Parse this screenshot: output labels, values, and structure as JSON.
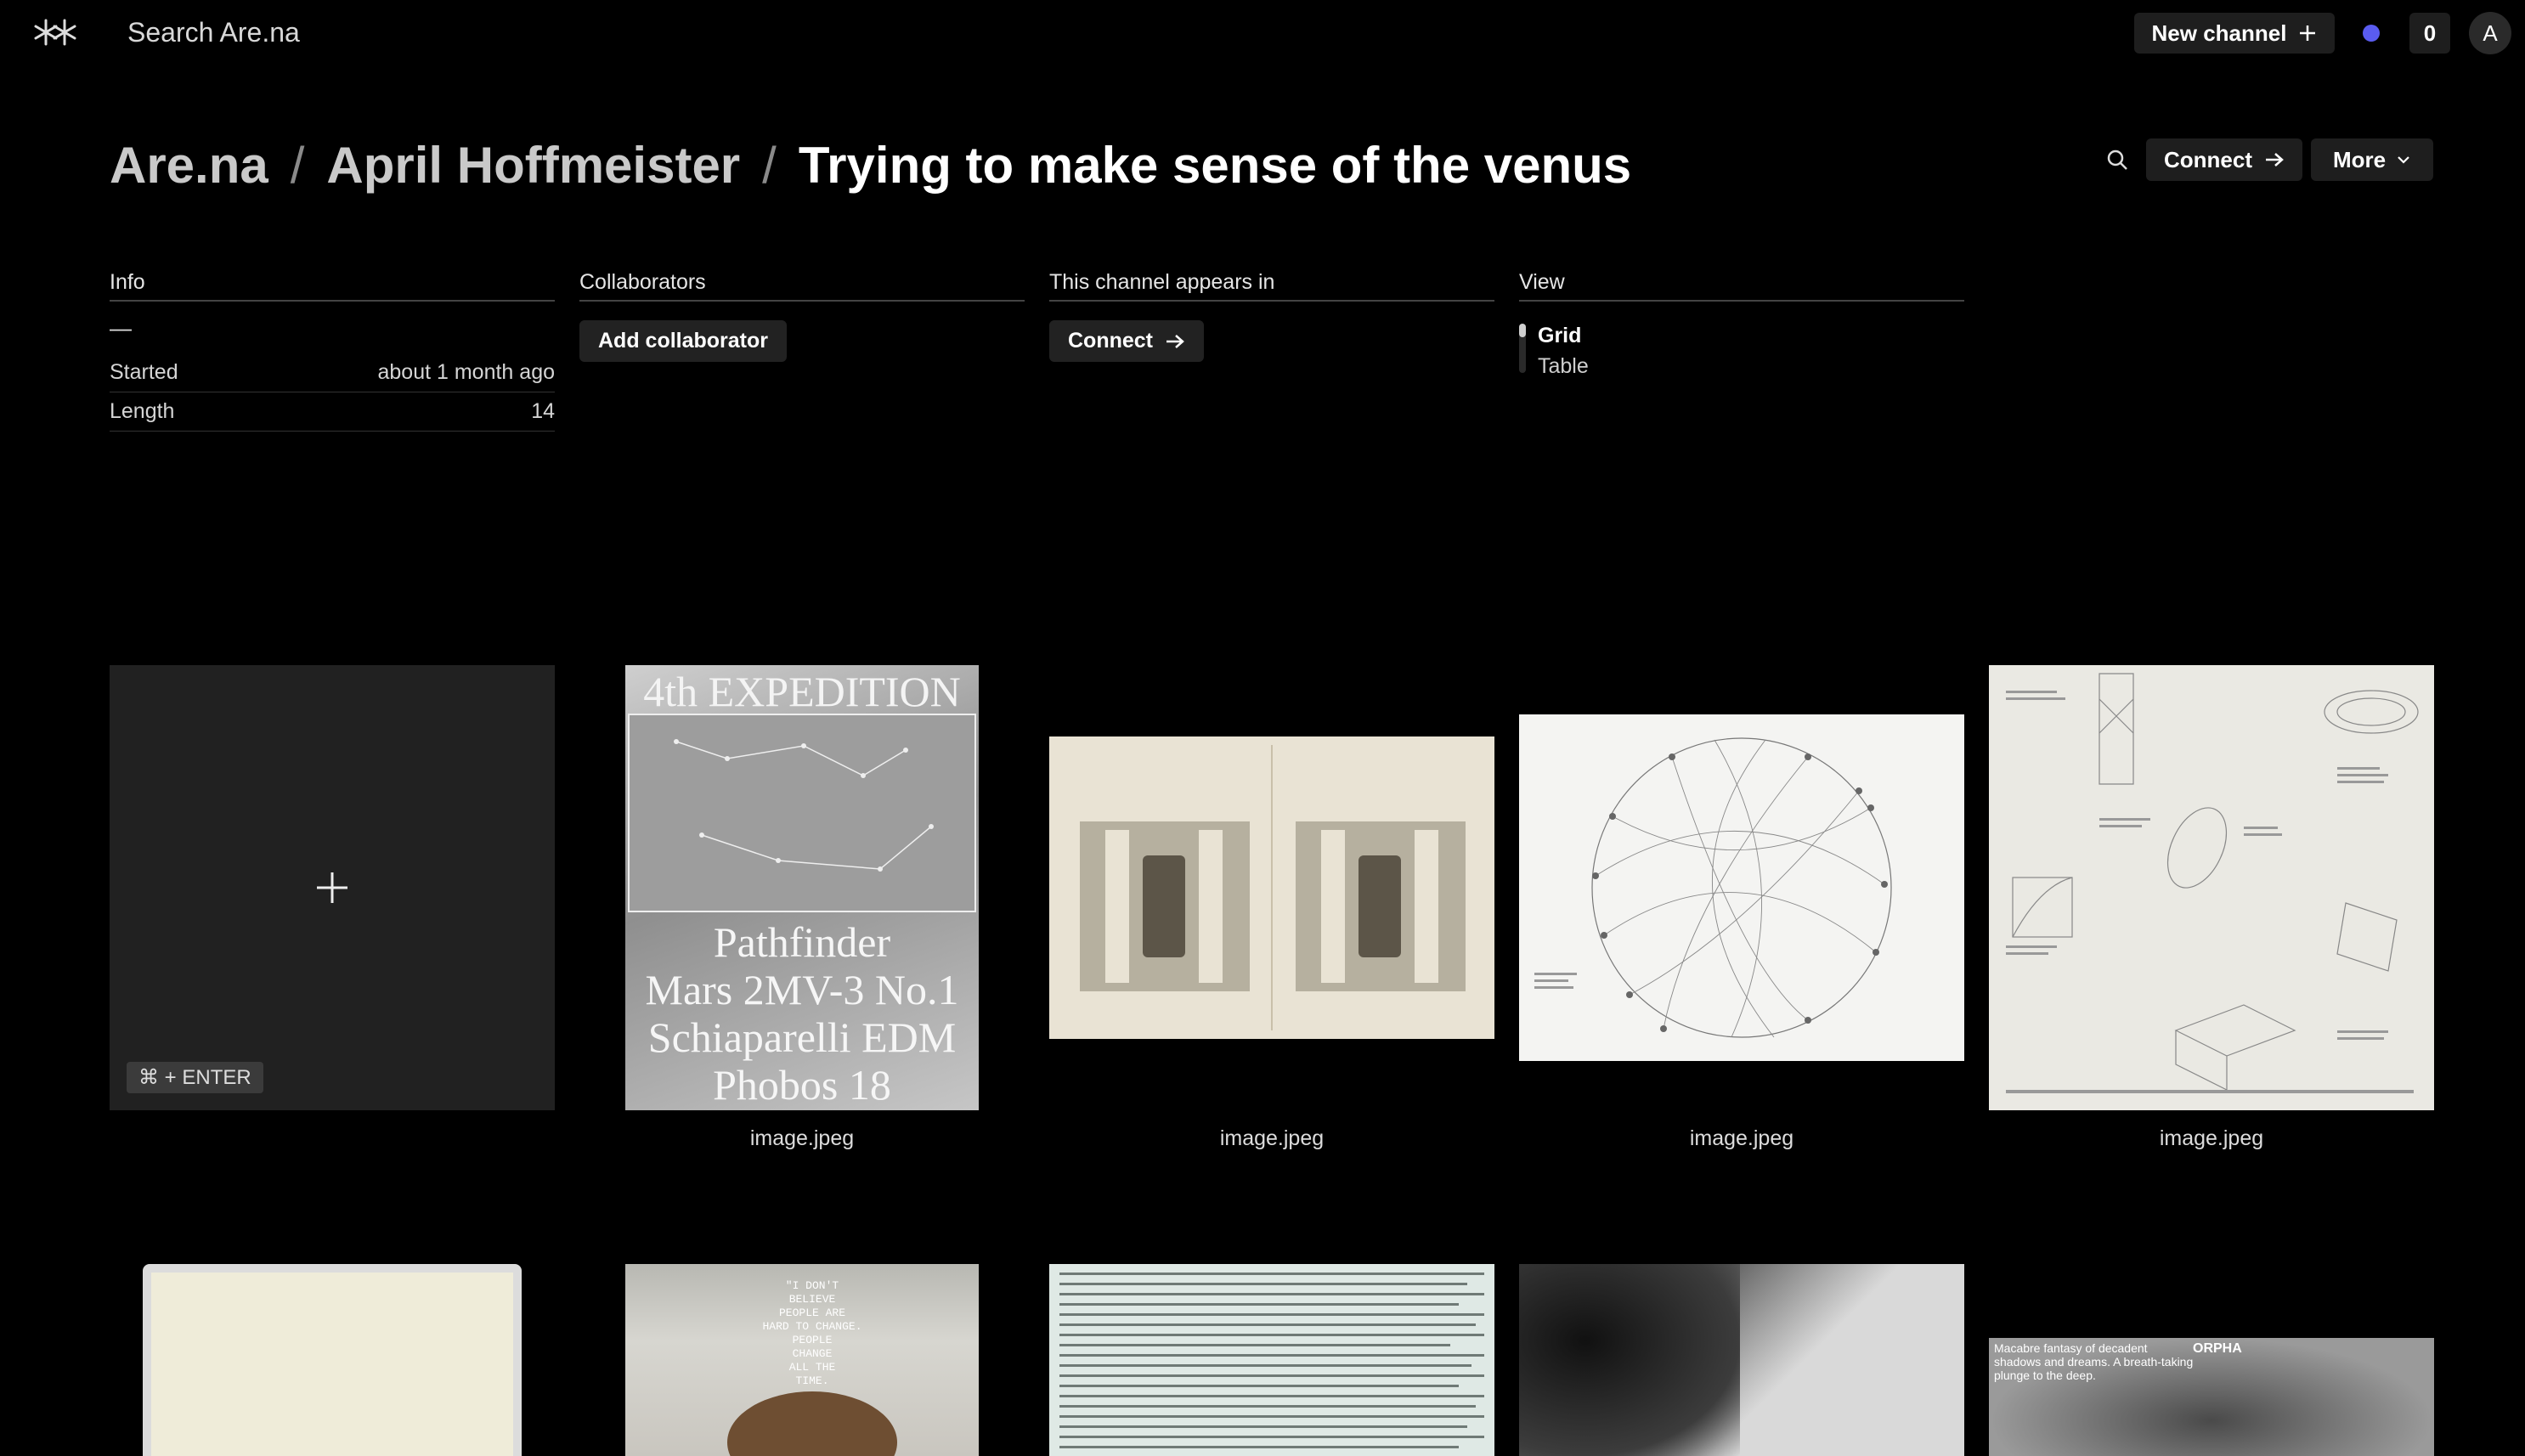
{
  "topbar": {
    "search_placeholder": "Search Are.na",
    "new_channel_label": "New channel",
    "notification_count": "0",
    "avatar_initial": "A",
    "dot_color": "#5a5cf0"
  },
  "breadcrumb": {
    "root": "Are.na",
    "user": "April Hoffmeister",
    "channel": "Trying to make sense of the venus",
    "separator": "/"
  },
  "actions": {
    "connect_label": "Connect",
    "more_label": "More"
  },
  "info": {
    "heading": "Info",
    "description": "—",
    "rows": [
      {
        "label": "Started",
        "value": "about 1 month ago"
      },
      {
        "label": "Length",
        "value": "14"
      }
    ]
  },
  "collaborators": {
    "heading": "Collaborators",
    "button_label": "Add collaborator"
  },
  "appears_in": {
    "heading": "This channel appears in",
    "button_label": "Connect"
  },
  "view": {
    "heading": "View",
    "options": [
      "Grid",
      "Table"
    ],
    "selected": "Grid"
  },
  "add_block": {
    "shortcut": "⌘ + ENTER"
  },
  "blocks": [
    {
      "caption": "image.jpeg",
      "text_lines": [
        "4th EXPEDITION",
        "Pathfinder",
        "Mars 2MV-3 No.1",
        "Schiaparelli EDM",
        "Phobos 18"
      ]
    },
    {
      "caption": "image.jpeg"
    },
    {
      "caption": "image.jpeg"
    },
    {
      "caption": "image.jpeg"
    },
    {
      "caption": ""
    },
    {
      "caption": "",
      "text_lines": [
        "\"I DON'T",
        "BELIEVE",
        "PEOPLE ARE",
        "HARD TO CHANGE.",
        "PEOPLE",
        "CHANGE",
        "ALL THE",
        "TIME."
      ]
    },
    {
      "caption": ""
    },
    {
      "caption": ""
    },
    {
      "caption": "",
      "text_lines": [
        "Macabre fantasy of decadent",
        "shadows and dreams. A breath-taking",
        "plunge to the deep.",
        "ORPHA"
      ]
    }
  ]
}
